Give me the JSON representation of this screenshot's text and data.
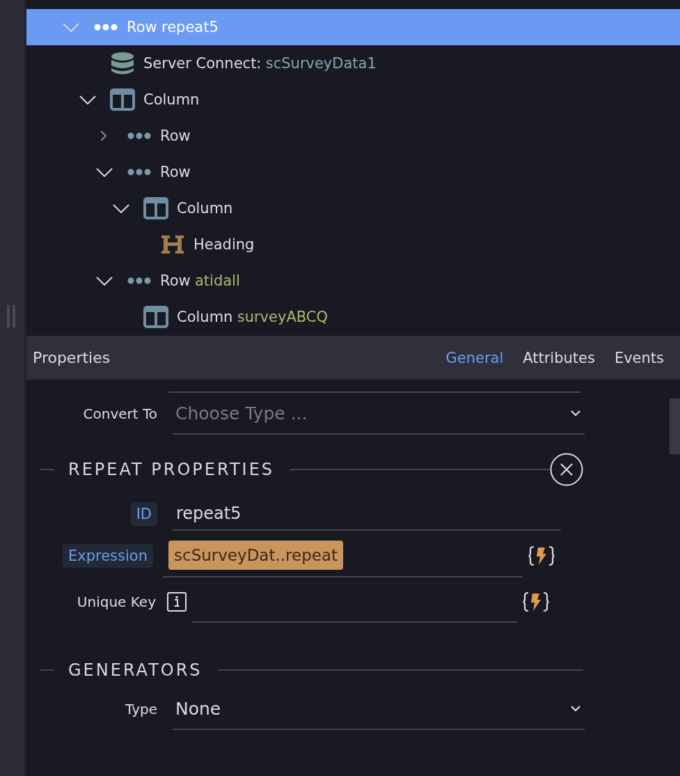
{
  "tree": [
    {
      "label": "Row",
      "detail": "repeat5",
      "kind": "row",
      "expanded": true,
      "selected": true,
      "children": [
        {
          "label": "Server Connect:",
          "detail": "scSurveyData1",
          "kind": "data",
          "selected": false
        },
        {
          "label": "Column",
          "kind": "column",
          "expanded": true,
          "selected": false,
          "children": [
            {
              "label": "Row",
              "kind": "row",
              "expanded": false,
              "selected": false
            },
            {
              "label": "Row",
              "kind": "row",
              "expanded": true,
              "selected": false,
              "children": [
                {
                  "label": "Column",
                  "kind": "column",
                  "expanded": true,
                  "selected": false,
                  "children": [
                    {
                      "label": "Heading",
                      "kind": "heading",
                      "selected": false
                    }
                  ]
                }
              ]
            },
            {
              "label": "Row",
              "detail": "atidall",
              "kind": "row",
              "expanded": true,
              "selected": false,
              "children": [
                {
                  "label": "Column",
                  "detail": "surveyABCQ",
                  "kind": "column",
                  "selected": false
                }
              ]
            }
          ]
        }
      ]
    }
  ],
  "properties": {
    "title": "Properties",
    "tabs": [
      {
        "label": "General",
        "selected": true
      },
      {
        "label": "Attributes",
        "selected": false
      },
      {
        "label": "Events",
        "selected": false
      }
    ],
    "convert_to": {
      "label": "Convert To",
      "placeholder": "Choose Type ..."
    },
    "repeat": {
      "title": "REPEAT PROPERTIES",
      "id_label": "ID",
      "id_value": "repeat5",
      "expression_label": "Expression",
      "expression_value": "scSurveyDat..repeat",
      "unique_key_label": "Unique Key"
    },
    "generators": {
      "title": "GENERATORS",
      "type_label": "Type",
      "type_value": "None"
    }
  }
}
